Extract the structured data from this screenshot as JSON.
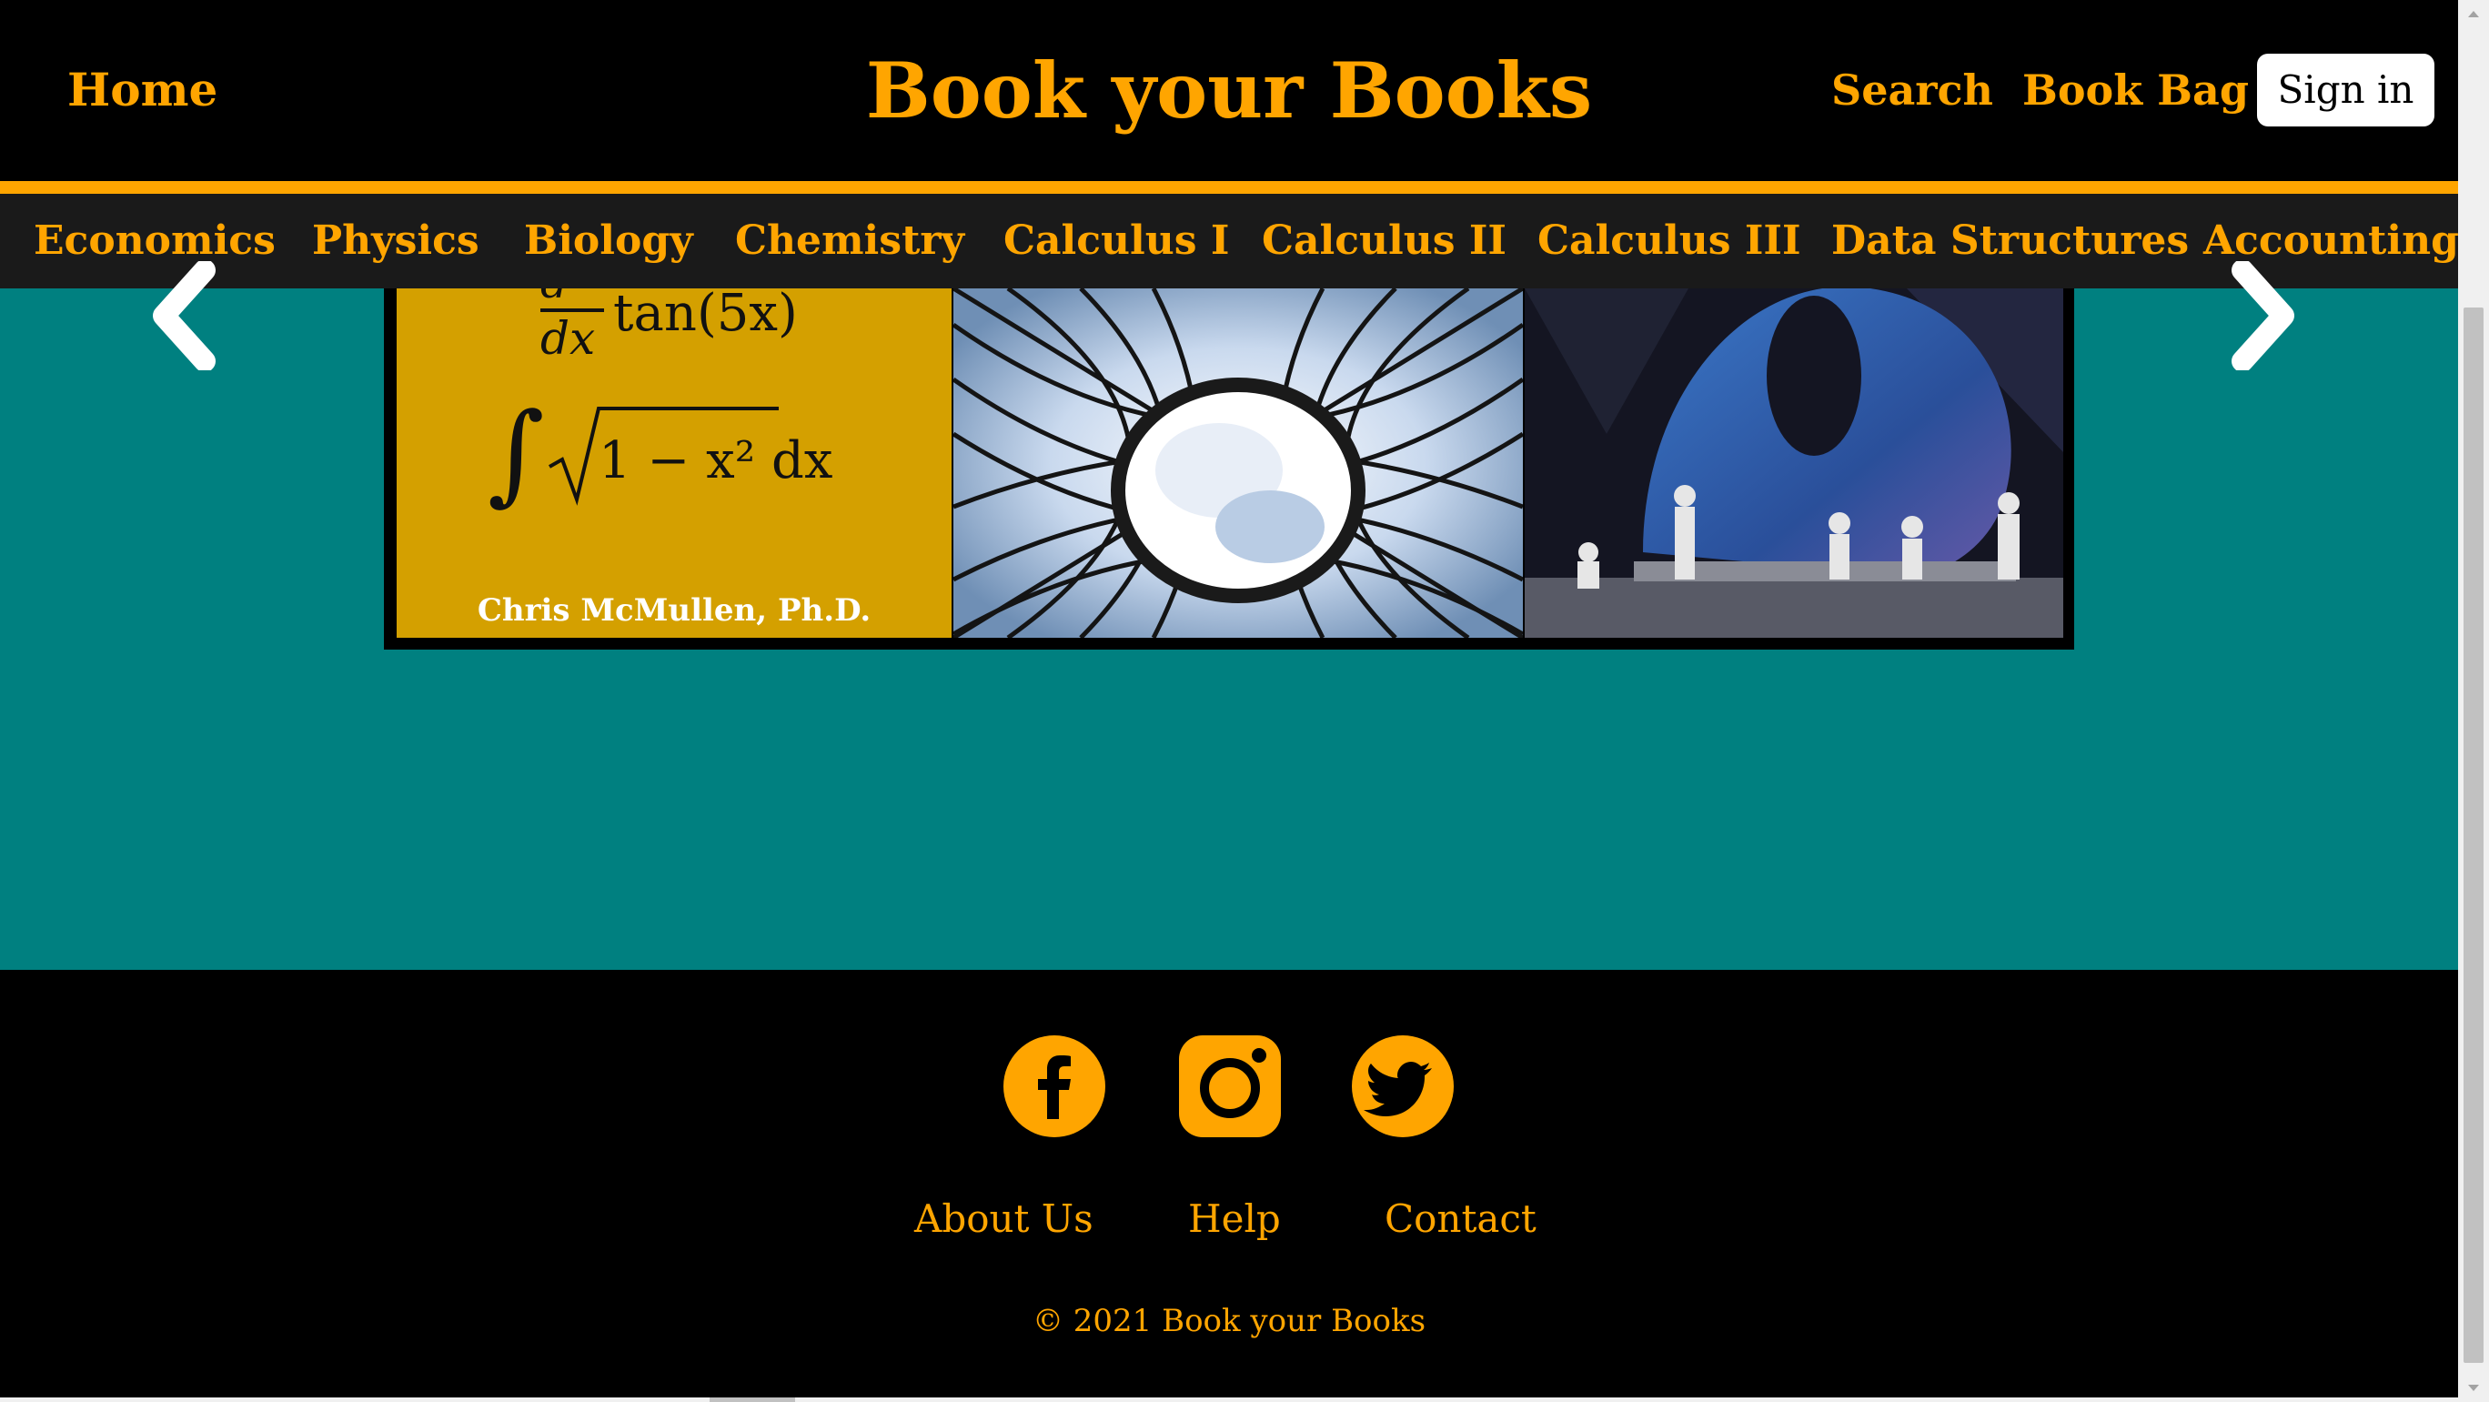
{
  "header": {
    "home_label": "Home",
    "brand": "Book your Books",
    "search_label": "Search",
    "bag_label": "Book Bag",
    "signin_label": "Sign in"
  },
  "categories": [
    "Economics",
    "Physics",
    "Biology",
    "Chemistry",
    "Calculus I",
    "Calculus II",
    "Calculus III",
    "Data Structures",
    "Accounting"
  ],
  "carousel": {
    "slide1": {
      "formula_1": "tan(5x)",
      "formula_2": "1 − x² dx",
      "author": "Chris McMullen, Ph.D."
    }
  },
  "footer": {
    "about_label": "About Us",
    "help_label": "Help",
    "contact_label": "Contact",
    "copyright": "© 2021 Book your Books"
  },
  "colors": {
    "accent": "#FFA500",
    "teal": "#008080",
    "dark_bar": "#1a1a1a"
  }
}
